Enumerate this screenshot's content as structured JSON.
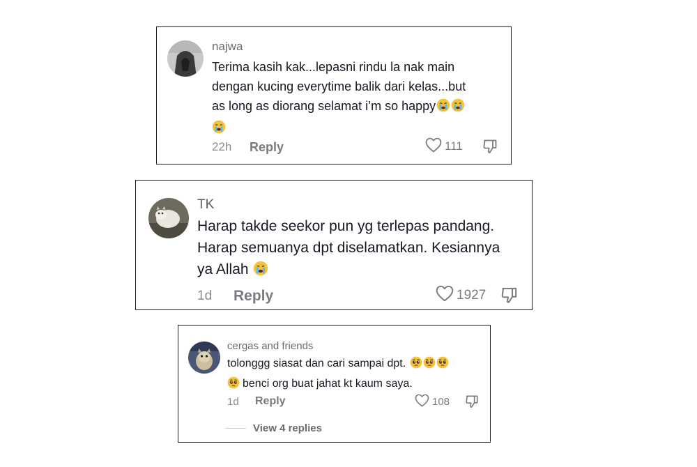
{
  "comments": [
    {
      "username": "najwa",
      "lines": [
        "Terima kasih kak...lepasni rindu la nak main",
        "dengan kucing everytime balik dari kelas...but",
        "as long as diorang selamat i’m so happy"
      ],
      "emoji": "crying-face",
      "time": "22h",
      "reply_label": "Reply",
      "likes": "111"
    },
    {
      "username": "TK",
      "lines": [
        "Harap takde seekor pun yg terlepas pandang.",
        "Harap semuanya dpt diselamatkan. Kesiannya",
        "ya Allah"
      ],
      "emoji": "crying-face",
      "time": "1d",
      "reply_label": "Reply",
      "likes": "1927"
    },
    {
      "username": "cergas and friends",
      "lines": [
        "tolonggg siasat dan cari sampai dpt.",
        "benci org buat jahat kt kaum saya."
      ],
      "emoji": "pleading-face",
      "time": "1d",
      "reply_label": "Reply",
      "likes": "108",
      "view_replies": "View 4 replies"
    }
  ]
}
